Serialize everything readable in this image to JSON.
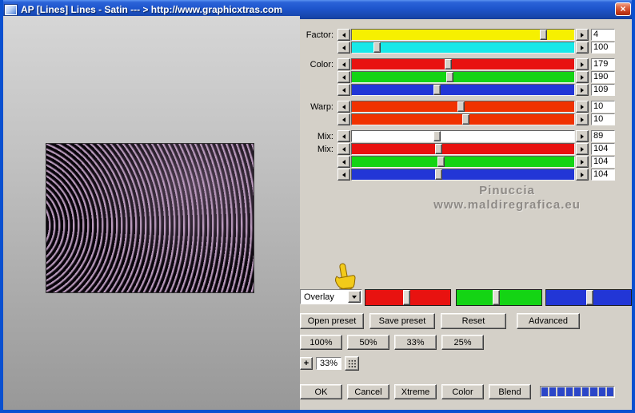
{
  "window": {
    "title": "AP [Lines]  Lines - Satin    --- > http://www.graphicxtras.com",
    "close_label": "×"
  },
  "sliders": [
    {
      "label": "Factor:",
      "value": "4",
      "color": "#f6f000",
      "thumb": 86,
      "gap": false
    },
    {
      "label": "",
      "value": "100",
      "color": "#18e8e8",
      "thumb": 11,
      "gap": false
    },
    {
      "label": "Color:",
      "value": "179",
      "color": "#e81210",
      "thumb": 43,
      "gap": true
    },
    {
      "label": "",
      "value": "190",
      "color": "#14d414",
      "thumb": 44,
      "gap": false
    },
    {
      "label": "",
      "value": "109",
      "color": "#2236d6",
      "thumb": 38,
      "gap": false
    },
    {
      "label": "Warp:",
      "value": "10",
      "color": "#f03200",
      "thumb": 49,
      "gap": true
    },
    {
      "label": "",
      "value": "10",
      "color": "#f03200",
      "thumb": 51,
      "gap": false
    },
    {
      "label": "Mix:",
      "value": "89",
      "color": "#ffffff",
      "thumb": 38,
      "gap": true
    },
    {
      "label": "Mix:",
      "value": "104",
      "color": "#e81210",
      "thumb": 39,
      "gap": false
    },
    {
      "label": "",
      "value": "104",
      "color": "#14d414",
      "thumb": 40,
      "gap": false
    },
    {
      "label": "",
      "value": "104",
      "color": "#2236d6",
      "thumb": 39,
      "gap": false
    }
  ],
  "watermark": {
    "line1": "Pinuccia",
    "line2": "www.maldiregrafica.eu"
  },
  "blend": {
    "mode": "Overlay",
    "channels": [
      {
        "name": "red",
        "color": "#e81210",
        "thumb": 48
      },
      {
        "name": "green",
        "color": "#14d414",
        "thumb": 46
      },
      {
        "name": "blue",
        "color": "#2236d6",
        "thumb": 51
      }
    ]
  },
  "preset_buttons": {
    "open": "Open preset",
    "save": "Save preset",
    "reset": "Reset",
    "advanced": "Advanced"
  },
  "zoom_buttons": {
    "z100": "100%",
    "z50": "50%",
    "z33": "33%",
    "z25": "25%"
  },
  "zoom_control": {
    "plus": "+",
    "value": "33%"
  },
  "action_buttons": {
    "ok": "OK",
    "cancel": "Cancel",
    "xtreme": "Xtreme",
    "color": "Color",
    "blend": "Blend"
  },
  "progress": {
    "segments": 9,
    "color": "#2b46c8"
  }
}
